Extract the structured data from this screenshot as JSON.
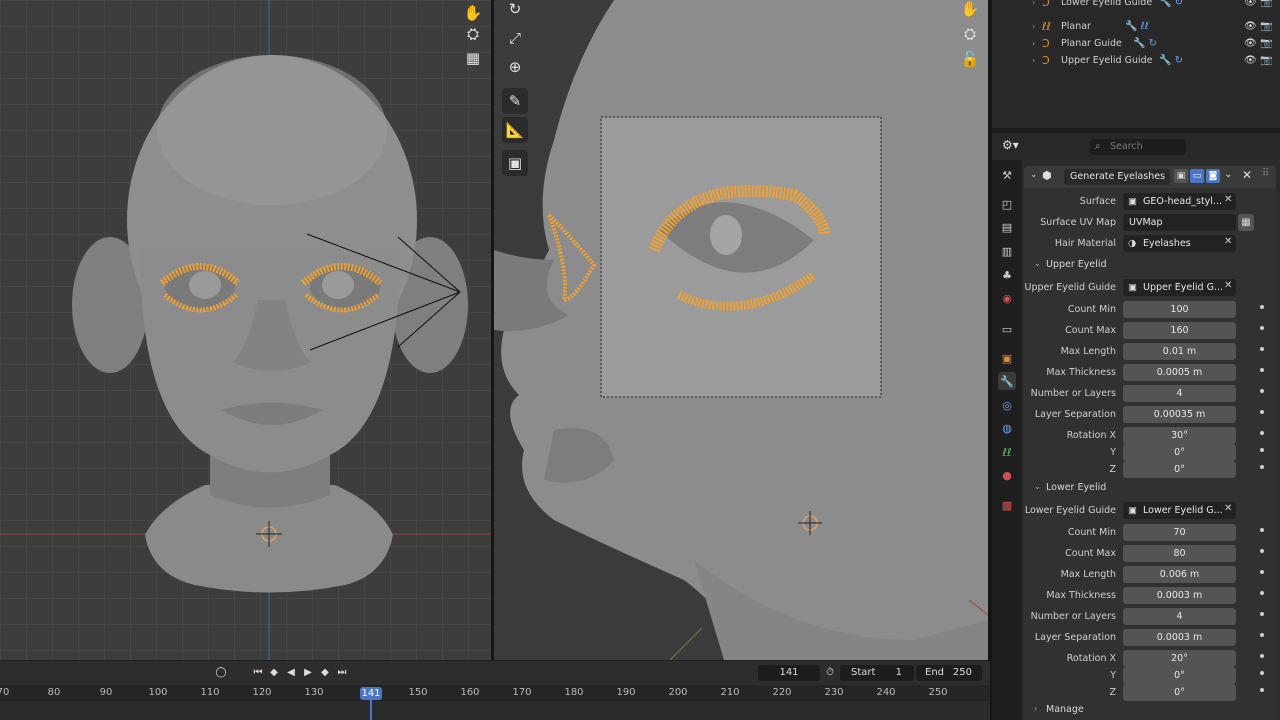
{
  "outliner": {
    "items": [
      {
        "name": "Lower Eyelid Guide"
      },
      {
        "name": "Planar"
      },
      {
        "name": "Planar Guide"
      },
      {
        "name": "Upper Eyelid Guide"
      }
    ]
  },
  "properties": {
    "search_placeholder": "Search",
    "modifier_name": "Generate Eyelashes",
    "surface_label": "Surface",
    "surface_value": "GEO-head_styl...",
    "surface_uv_label": "Surface UV Map",
    "surface_uv_value": "UVMap",
    "hair_material_label": "Hair Material",
    "hair_material_value": "Eyelashes",
    "upper": {
      "section": "Upper Eyelid",
      "guide_label": "Upper Eyelid Guide",
      "guide_value": "Upper Eyelid G...",
      "rows": [
        {
          "label": "Count Min",
          "value": "100"
        },
        {
          "label": "Count Max",
          "value": "160"
        },
        {
          "label": "Max Length",
          "value": "0.01 m"
        },
        {
          "label": "Max Thickness",
          "value": "0.0005 m"
        },
        {
          "label": "Number or Layers",
          "value": "4"
        },
        {
          "label": "Layer Separation",
          "value": "0.00035 m"
        },
        {
          "label": "Rotation X",
          "value": "30°"
        },
        {
          "label": "Y",
          "value": "0°"
        },
        {
          "label": "Z",
          "value": "0°"
        }
      ]
    },
    "lower": {
      "section": "Lower Eyelid",
      "guide_label": "Lower Eyelid Guide",
      "guide_value": "Lower Eyelid G...",
      "rows": [
        {
          "label": "Count Min",
          "value": "70"
        },
        {
          "label": "Count Max",
          "value": "80"
        },
        {
          "label": "Max Length",
          "value": "0.006 m"
        },
        {
          "label": "Max Thickness",
          "value": "0.0003 m"
        },
        {
          "label": "Number or Layers",
          "value": "4"
        },
        {
          "label": "Layer Separation",
          "value": "0.0003 m"
        },
        {
          "label": "Rotation X",
          "value": "20°"
        },
        {
          "label": "Y",
          "value": "0°"
        },
        {
          "label": "Z",
          "value": "0°"
        }
      ]
    },
    "manage": "Manage"
  },
  "timeline": {
    "current_frame": "141",
    "start_label": "Start",
    "start_value": "1",
    "end_label": "End",
    "end_value": "250",
    "ticks": [
      "70",
      "80",
      "90",
      "100",
      "110",
      "120",
      "130",
      "141",
      "150",
      "160",
      "170",
      "180",
      "190",
      "200",
      "210",
      "220",
      "230",
      "240",
      "250"
    ]
  },
  "colors": {
    "accent": "#4a76c5",
    "hair_orange": "#f0a030",
    "modifier_icon_blue": "#6ea4e8"
  }
}
